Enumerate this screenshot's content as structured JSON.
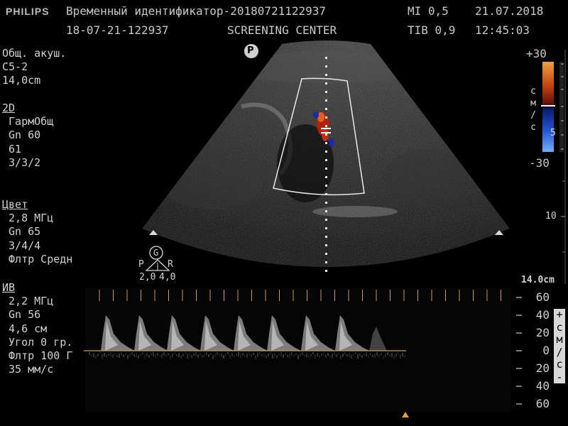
{
  "header": {
    "brand": "PHILIPS",
    "patient_label": "Временный идентификатор-20180721122937",
    "mi": "MI 0,5",
    "date": "21.07.2018",
    "exam_id": "18-07-21-122937",
    "facility": "SCREENING CENTER",
    "tib": "TIB 0,9",
    "time": "12:45:03"
  },
  "preset": {
    "lines": [
      "Общ. акуш.",
      "C5-2",
      "14,0cm"
    ]
  },
  "mode_2d": {
    "title": "2D",
    "lines": [
      " ГармОбщ",
      " Gn 60",
      " 61",
      " 3/3/2"
    ]
  },
  "mode_color": {
    "title": "Цвет",
    "lines": [
      " 2,8 МГц",
      " Gn 65",
      " 3/4/4",
      " Флтр Средн"
    ]
  },
  "mode_pw": {
    "title": "ИВ",
    "lines": [
      " 2,2 МГц",
      " Gn 56",
      " 4,6 см",
      " Угол 0 гр.",
      " Флтр 100 Г",
      " 35 мм/с"
    ]
  },
  "color_bar": {
    "top_value": "+30",
    "bottom_value": "-30",
    "unit_letters": [
      "с",
      "м",
      "/",
      "с"
    ],
    "side_mark": "5",
    "colors": [
      "#f0a040",
      "#c04010",
      "#6a0a0a",
      "#000000",
      "#0a1a7a",
      "#2050d0",
      "#60a0f0"
    ]
  },
  "depth": {
    "mark": "10",
    "total": "14.0cm"
  },
  "probe": {
    "orientation_letter": "P",
    "guide_letter": "G",
    "left_letter": "P",
    "right_letter": "R",
    "left_value": "2,0",
    "right_value": "4,0"
  },
  "doppler_scale": {
    "ticks": [
      "60",
      "40",
      "20",
      "0",
      "20",
      "40",
      "60"
    ],
    "unit_letters": [
      "+",
      "с",
      "м",
      "/",
      "с",
      "-"
    ]
  },
  "colors": {
    "text": "#d0d0d0",
    "baseline": "#c8a050",
    "marker": "#e8a030"
  }
}
